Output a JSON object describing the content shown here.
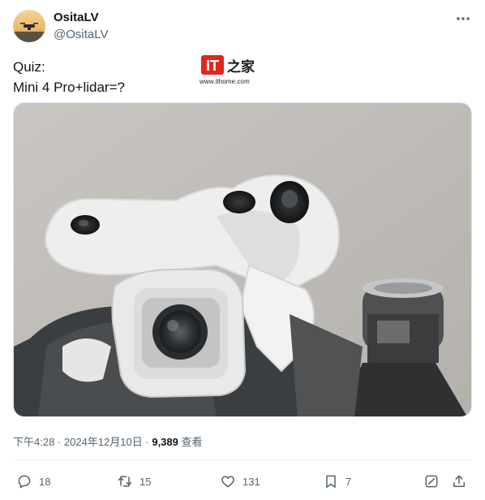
{
  "user": {
    "display_name": "OsitaLV",
    "handle": "@OsitaLV"
  },
  "tweet": {
    "lines": [
      "Quiz:",
      "Mini 4 Pro+lidar=?"
    ],
    "time": "下午4:28",
    "separator": "·",
    "date": "2024年12月10日",
    "views_count": "9,389",
    "views_label": "查看"
  },
  "watermark": {
    "logo_text": "IT",
    "logo_sub": "之家",
    "url": "www.ithome.com"
  },
  "actions": {
    "replies": "18",
    "retweets": "15",
    "likes": "131",
    "bookmarks": "7"
  },
  "icons": {
    "more": "more-icon",
    "reply": "reply-icon",
    "retweet": "retweet-icon",
    "like": "heart-icon",
    "bookmark": "bookmark-icon",
    "grok": "grok-icon",
    "share": "share-icon"
  },
  "colors": {
    "text_primary": "#0f1419",
    "text_secondary": "#536471",
    "watermark_red": "#e1261c"
  }
}
